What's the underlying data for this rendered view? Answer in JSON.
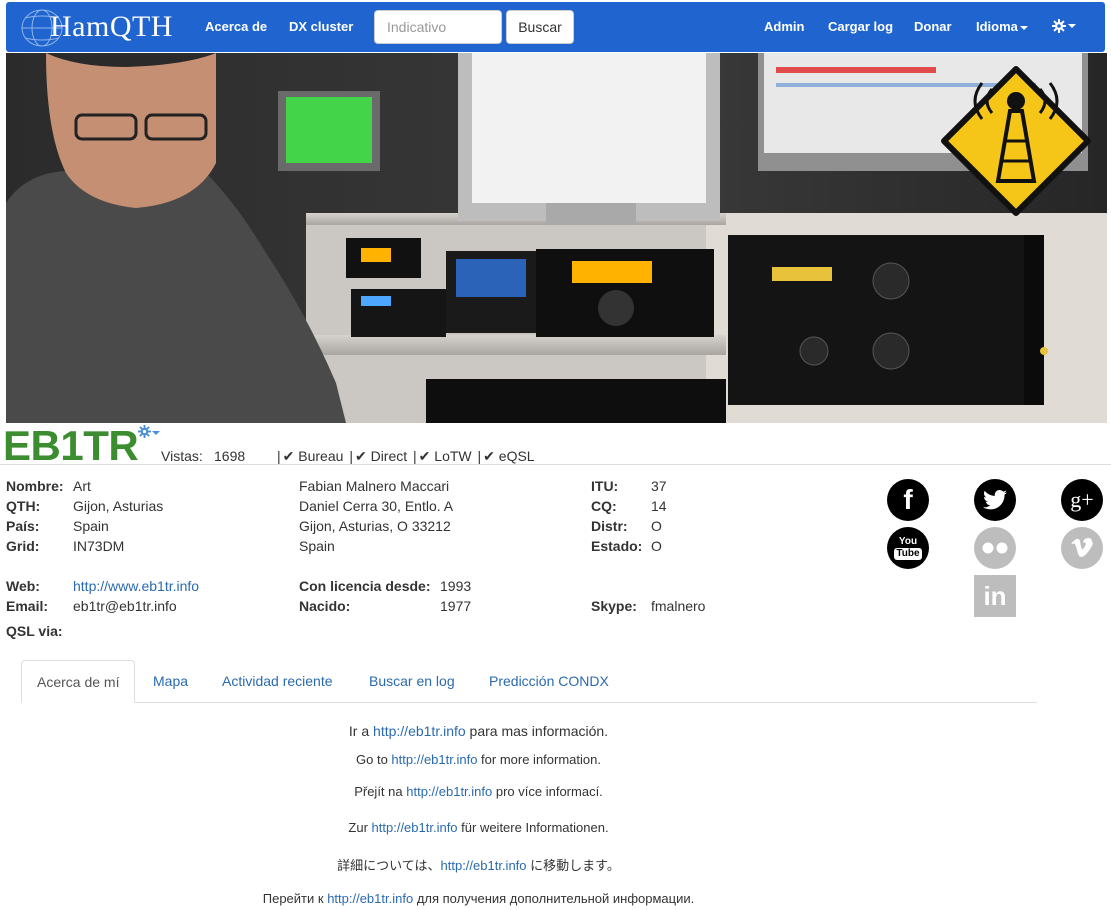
{
  "navbar": {
    "brand": "HamQTH",
    "links": {
      "about": "Acerca de",
      "dx_cluster": "DX cluster",
      "admin": "Admin",
      "upload_log": "Cargar log",
      "donate": "Donar",
      "language": "Idioma"
    },
    "search": {
      "placeholder": "Indicativo",
      "button": "Buscar"
    }
  },
  "profile": {
    "callsign": "EB1TR",
    "views_label": "Vistas:",
    "views": "1698",
    "qsl_methods": [
      "Bureau",
      "Direct",
      "LoTW",
      "eQSL"
    ],
    "col1": {
      "nombre_label": "Nombre:",
      "nombre": "Art",
      "qth_label": "QTH:",
      "qth": "Gijon, Asturias",
      "pais_label": "País:",
      "pais": "Spain",
      "grid_label": "Grid:",
      "grid": "IN73DM",
      "web_label": "Web:",
      "web": "http://www.eb1tr.info",
      "email_label": "Email:",
      "email": "eb1tr@eb1tr.info",
      "qsl_label": "QSL via:"
    },
    "address": [
      "Fabian Malnero Maccari",
      "Daniel Cerra 30, Entlo. A",
      "Gijon, Asturias, O 33212",
      "Spain"
    ],
    "licensed_label": "Con licencia desde:",
    "licensed": "1993",
    "born_label": "Nacido:",
    "born": "1977",
    "col3": {
      "itu_label": "ITU:",
      "itu": "37",
      "cq_label": "CQ:",
      "cq": "14",
      "distr_label": "Distr:",
      "distr": "O",
      "estado_label": "Estado:",
      "estado": "O",
      "skype_label": "Skype:",
      "skype": "fmalnero"
    }
  },
  "social": {
    "facebook": "f",
    "googleplus": "g+",
    "youtube": [
      "You",
      "Tube"
    ],
    "linkedin": "in"
  },
  "tabs": [
    "Acerca de mí",
    "Mapa",
    "Actividad reciente",
    "Buscar en log",
    "Predicción CONDX"
  ],
  "about": {
    "link": "http://eb1tr.info",
    "lines": [
      {
        "pre": "Ir a ",
        "post": " para mas información."
      },
      {
        "pre": "Go to ",
        "post": " for more information."
      },
      {
        "pre": "Přejít na ",
        "post": " pro více informací."
      },
      {
        "pre": "Zur ",
        "post": " für weitere Informationen."
      },
      {
        "pre": "詳細については、",
        "post": " に移動します。"
      },
      {
        "pre": "Перейти к ",
        "post": " для получения дополнительной информации."
      }
    ]
  },
  "colors": {
    "navbar": "#2065cf",
    "callsign": "#3b8d2f",
    "link": "#2a6ab0",
    "warning_sign": "#f5c518"
  }
}
